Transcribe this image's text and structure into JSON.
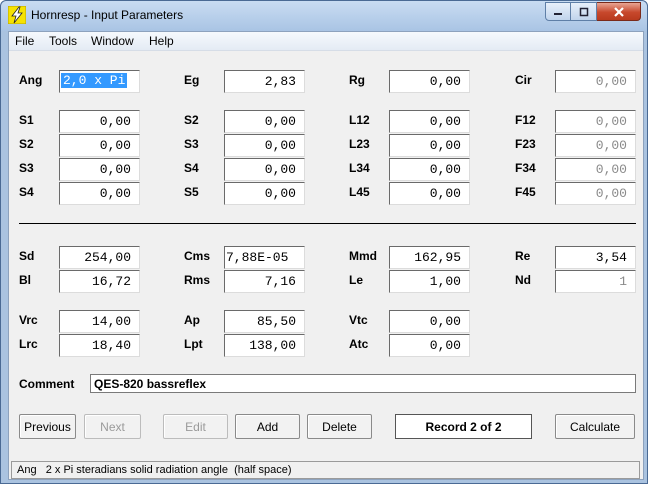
{
  "window": {
    "title": "Hornresp - Input Parameters"
  },
  "menu": [
    "File",
    "Tools",
    "Window",
    "Help"
  ],
  "row0": {
    "ang": {
      "label": "Ang",
      "value": "2,0 x Pi"
    },
    "eg": {
      "label": "Eg",
      "value": "2,83"
    },
    "rg": {
      "label": "Rg",
      "value": "0,00"
    },
    "cir": {
      "label": "Cir",
      "value": "0,00"
    }
  },
  "s_left": [
    {
      "label": "S1",
      "value": "0,00"
    },
    {
      "label": "S2",
      "value": "0,00"
    },
    {
      "label": "S3",
      "value": "0,00"
    },
    {
      "label": "S4",
      "value": "0,00"
    }
  ],
  "s_right": [
    {
      "label": "S2",
      "value": "0,00"
    },
    {
      "label": "S3",
      "value": "0,00"
    },
    {
      "label": "S4",
      "value": "0,00"
    },
    {
      "label": "S5",
      "value": "0,00"
    }
  ],
  "lengths": [
    {
      "label": "L12",
      "value": "0,00"
    },
    {
      "label": "L23",
      "value": "0,00"
    },
    {
      "label": "L34",
      "value": "0,00"
    },
    {
      "label": "L45",
      "value": "0,00"
    }
  ],
  "flares": [
    {
      "label": "F12",
      "value": "0,00"
    },
    {
      "label": "F23",
      "value": "0,00"
    },
    {
      "label": "F34",
      "value": "0,00"
    },
    {
      "label": "F45",
      "value": "0,00"
    }
  ],
  "driver": {
    "sd": {
      "label": "Sd",
      "value": "254,00"
    },
    "cms": {
      "label": "Cms",
      "value": "7,88E-05"
    },
    "mmd": {
      "label": "Mmd",
      "value": "162,95"
    },
    "re": {
      "label": "Re",
      "value": "3,54"
    },
    "bl": {
      "label": "Bl",
      "value": "16,72"
    },
    "rms": {
      "label": "Rms",
      "value": "7,16"
    },
    "le": {
      "label": "Le",
      "value": "1,00"
    },
    "nd": {
      "label": "Nd",
      "value": "1"
    }
  },
  "chambers": {
    "vrc": {
      "label": "Vrc",
      "value": "14,00"
    },
    "ap": {
      "label": "Ap",
      "value": "85,50"
    },
    "vtc": {
      "label": "Vtc",
      "value": "0,00"
    },
    "lrc": {
      "label": "Lrc",
      "value": "18,40"
    },
    "lpt": {
      "label": "Lpt",
      "value": "138,00"
    },
    "atc": {
      "label": "Atc",
      "value": "0,00"
    }
  },
  "comment": {
    "label": "Comment",
    "value": "QES-820 bassreflex"
  },
  "buttons": {
    "previous": "Previous",
    "next": "Next",
    "edit": "Edit",
    "add": "Add",
    "delete": "Delete",
    "calculate": "Calculate"
  },
  "record": "Record 2 of 2",
  "status": "Ang   2 x Pi steradians solid radiation angle  (half space)",
  "colors": {
    "selection": "#3399ff",
    "window_frame": "#aac3e0",
    "close_button": "#c7482c"
  }
}
